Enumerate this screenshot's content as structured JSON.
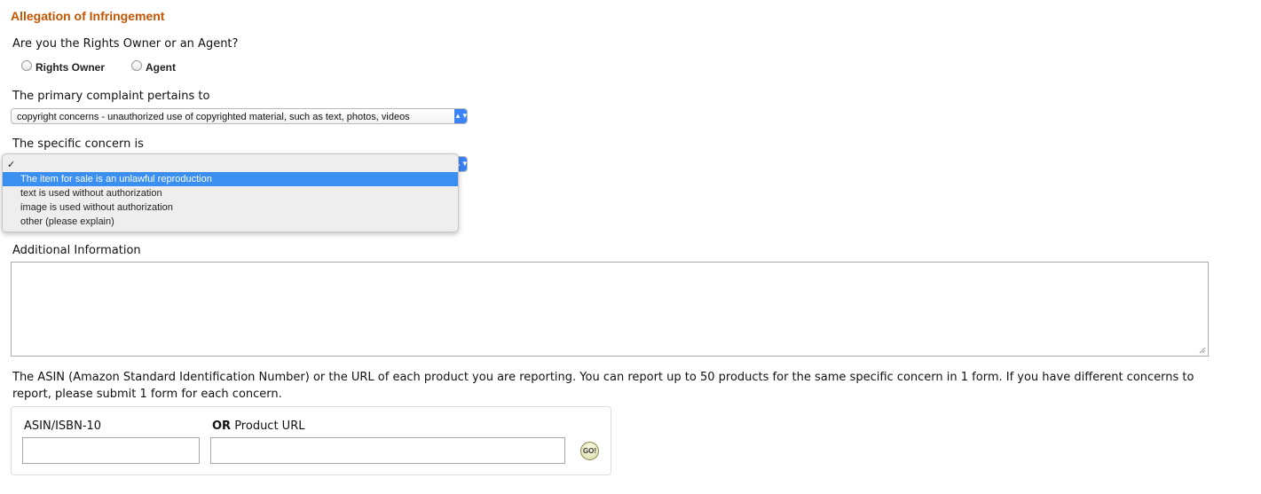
{
  "section_title": "Allegation of Infringement",
  "role_question": "Are you the Rights Owner or an Agent?",
  "role_options": [
    "Rights Owner",
    "Agent"
  ],
  "complaint_label": "The primary complaint pertains to",
  "complaint_value": "copyright concerns - unauthorized use of copyrighted material, such as text, photos, videos",
  "concern_label": "The specific concern is",
  "concern_dropdown": {
    "check": "✓",
    "options": [
      "The item for sale is an unlawful reproduction",
      "text is used without authorization",
      "image is used without authorization",
      "other (please explain)"
    ],
    "highlighted": "The item for sale is an unlawful reproduction"
  },
  "additional_info_label": "Additional Information",
  "asin_instructions": "The ASIN (Amazon Standard Identification Number) or the URL of each product you are reporting. You can report up to 50 products for the same specific concern in 1 form. If you have different concerns to report, please submit 1 form for each concern.",
  "asin_label": "ASIN/ISBN-10",
  "url_label_or": "OR",
  "url_label": " Product URL",
  "go_button": "GO!",
  "colors": {
    "title": "#c45500",
    "highlight": "#3b8ff0",
    "select_arrow": "#3b82f6"
  }
}
